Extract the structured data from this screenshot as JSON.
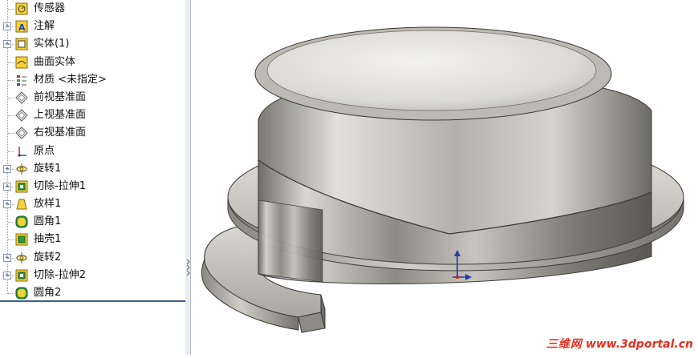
{
  "feature_tree": {
    "items": [
      {
        "label": "传感器",
        "icon": "sensor-icon",
        "expandable": false
      },
      {
        "label": "注解",
        "icon": "annotation-icon",
        "expandable": true
      },
      {
        "label": "实体(1)",
        "icon": "solid-bodies-icon",
        "expandable": true
      },
      {
        "label": "曲面实体",
        "icon": "surface-bodies-icon",
        "expandable": false
      },
      {
        "label": "材质 <未指定>",
        "icon": "material-icon",
        "expandable": false
      },
      {
        "label": "前视基准面",
        "icon": "plane-icon",
        "expandable": false
      },
      {
        "label": "上视基准面",
        "icon": "plane-icon",
        "expandable": false
      },
      {
        "label": "右视基准面",
        "icon": "plane-icon",
        "expandable": false
      },
      {
        "label": "原点",
        "icon": "origin-icon",
        "expandable": false
      },
      {
        "label": "旋转1",
        "icon": "revolve-icon",
        "expandable": true
      },
      {
        "label": "切除-拉伸1",
        "icon": "cut-extrude-icon",
        "expandable": true
      },
      {
        "label": "放样1",
        "icon": "loft-icon",
        "expandable": true
      },
      {
        "label": "圆角1",
        "icon": "fillet-icon",
        "expandable": false
      },
      {
        "label": "抽壳1",
        "icon": "shell-icon",
        "expandable": false
      },
      {
        "label": "旋转2",
        "icon": "revolve-icon",
        "expandable": true
      },
      {
        "label": "切除-拉伸2",
        "icon": "cut-extrude-icon",
        "expandable": true
      },
      {
        "label": "圆角2",
        "icon": "fillet-icon",
        "expandable": false
      }
    ]
  },
  "watermark": {
    "brand": "三维网",
    "url": "www.3dportal.cn",
    "color": "#e6301f"
  },
  "colors": {
    "accent_blue": "#1f3fa8",
    "icon_yellow": "#f4d23a",
    "icon_green": "#2f9a3a"
  }
}
